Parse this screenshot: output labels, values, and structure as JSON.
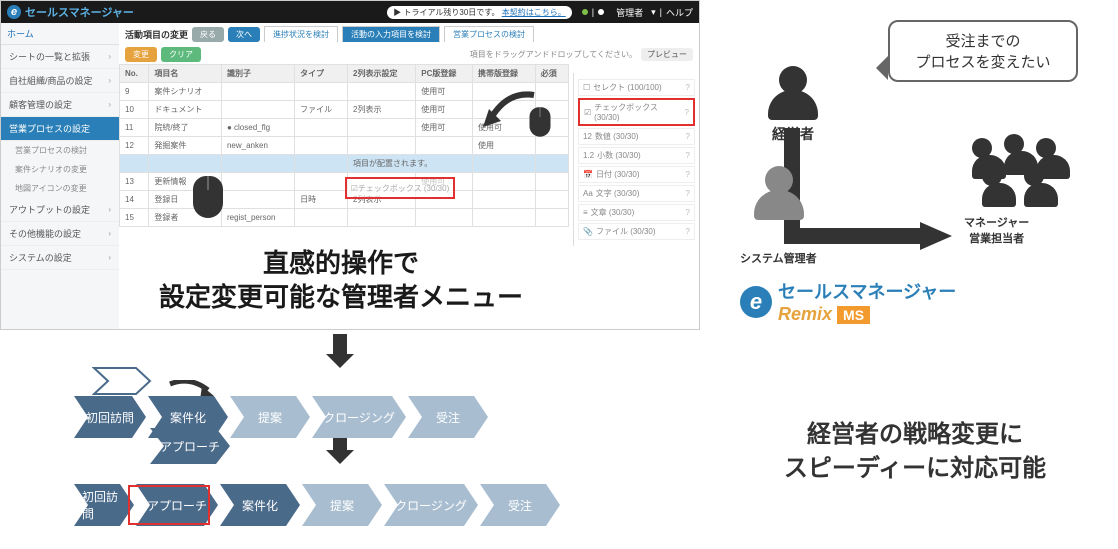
{
  "app": {
    "logo_text": "セールスマネージャー",
    "logo_sub": "Remix MS",
    "trial_prefix": "トライアル残り30日です。",
    "trial_link": "本契約はこちら。",
    "admin_label": "管理者",
    "help_label": "ヘルプ"
  },
  "sidebar": {
    "home": "ホーム",
    "items": [
      {
        "label": "シートの一覧と拡張"
      },
      {
        "label": "自社組織/商品の設定"
      },
      {
        "label": "顧客管理の設定"
      },
      {
        "label": "営業プロセスの設定",
        "active": true
      },
      {
        "label": "アウトプットの設定"
      },
      {
        "label": "その他機能の設定"
      },
      {
        "label": "システムの設定"
      }
    ],
    "subs": [
      {
        "label": "営業プロセスの検討"
      },
      {
        "label": "案件シナリオの変更"
      },
      {
        "label": "地図アイコンの変更"
      }
    ]
  },
  "main": {
    "title": "活動項目の変更",
    "back": "戻る",
    "next": "次へ",
    "tabs": [
      "進捗状況を検討",
      "活動の入力項目を検討",
      "営業プロセスの検討"
    ],
    "btn_change": "変更",
    "btn_clear": "クリア",
    "hint": "項目をドラッグアンドドロップしてください。",
    "preview": "プレビュー",
    "cols": [
      "No.",
      "項目名",
      "識別子",
      "タイプ",
      "2列表示設定",
      "PC版登録",
      "携帯版登録",
      "必須"
    ],
    "rows": [
      {
        "no": "9",
        "name": "案件シナリオ",
        "ident": "",
        "type": "",
        "two": "",
        "pc": "使用可",
        "mb": ""
      },
      {
        "no": "10",
        "name": "ドキュメント",
        "ident": "",
        "type": "ファイル",
        "two": "2列表示",
        "pc": "使用可",
        "mb": ""
      },
      {
        "no": "11",
        "name": "院続/終了",
        "ident": "closed_flg",
        "type": "",
        "two": "",
        "pc": "使用可",
        "mb": "使用可"
      },
      {
        "no": "12",
        "name": "発掘案件",
        "ident": "new_anken",
        "type": "",
        "two": "",
        "pc": "",
        "mb": "使用"
      },
      {
        "no": "",
        "name": "",
        "ident": "",
        "type": "",
        "two": "項目が配置されます。",
        "pc": "",
        "mb": ""
      },
      {
        "no": "13",
        "name": "更新情報",
        "ident": "",
        "type": "",
        "two": "",
        "pc": "使用可",
        "mb": ""
      },
      {
        "no": "14",
        "name": "登録日",
        "ident": "",
        "type": "日時",
        "two": "2列表示",
        "pc": "",
        "mb": ""
      },
      {
        "no": "15",
        "name": "登録者",
        "ident": "regist_person",
        "type": "",
        "two": "",
        "pc": "",
        "mb": ""
      }
    ],
    "drag_chk": "チェックボックス (30/30)"
  },
  "right_panel": {
    "options": [
      {
        "icon": "☐",
        "label": "セレクト (100/100)"
      },
      {
        "icon": "☑",
        "label": "チェックボックス (30/30)",
        "ring": true
      },
      {
        "icon": "12",
        "label": "数値 (30/30)"
      },
      {
        "icon": "1.2",
        "label": "小数 (30/30)"
      },
      {
        "icon": "📅",
        "label": "日付 (30/30)"
      },
      {
        "icon": "Aa",
        "label": "文字 (30/30)"
      },
      {
        "icon": "≡",
        "label": "文章 (30/30)"
      },
      {
        "icon": "📎",
        "label": "ファイル (30/30)"
      }
    ]
  },
  "caption": {
    "line1": "直感的操作で",
    "line2": "設定変更可能な管理者メニュー"
  },
  "roles": {
    "exec": "経営者",
    "sys": "システム管理者",
    "mgr1": "マネージャー",
    "mgr2": "営業担当者",
    "speech1": "受注までの",
    "speech2": "プロセスを変えたい"
  },
  "logo2": {
    "brand": "セールスマネージャー",
    "remix": "Remix",
    "ms": "MS"
  },
  "process": {
    "a": [
      "初回訪問",
      "案件化",
      "提案",
      "クロージング",
      "受注"
    ],
    "a_extra": "アプローチ",
    "b": [
      "初回訪問",
      "アプローチ",
      "案件化",
      "提案",
      "クロージング",
      "受注"
    ]
  },
  "big_msg": {
    "line1": "経営者の戦略変更に",
    "line2": "スピーディーに対応可能"
  }
}
